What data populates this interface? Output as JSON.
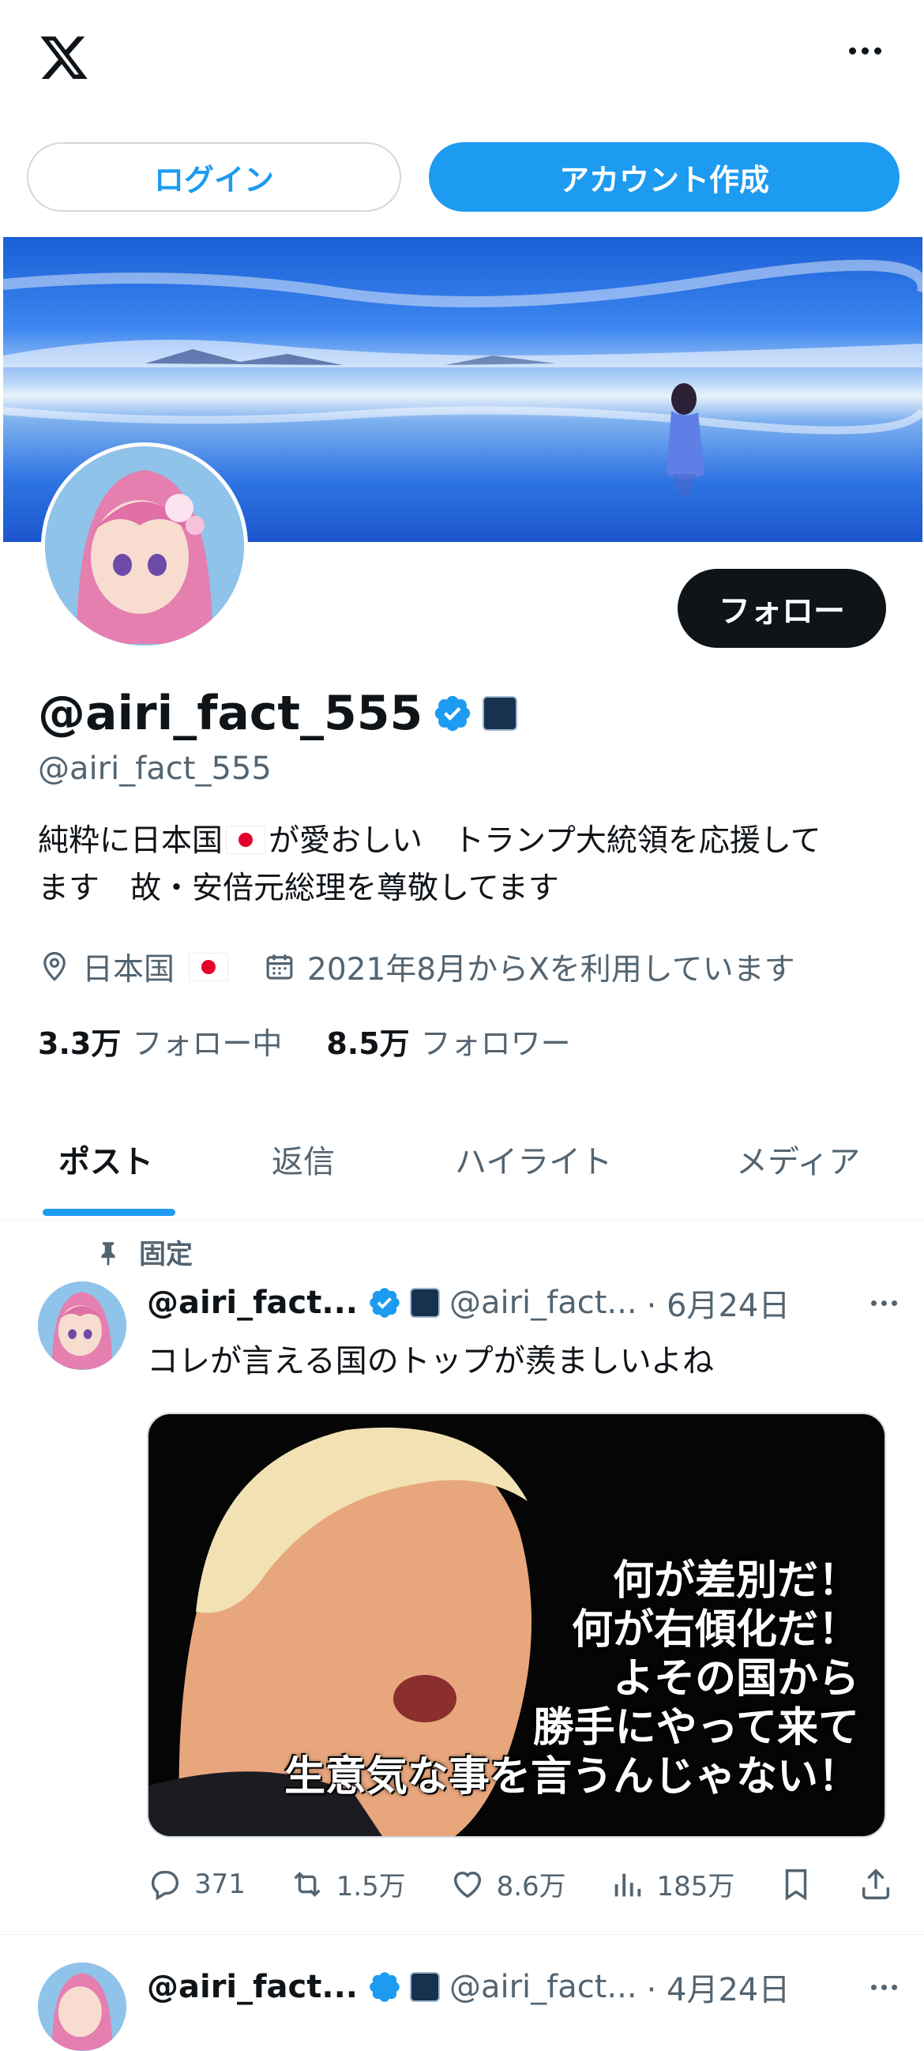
{
  "header": {
    "logo_icon": "x-logo-icon",
    "menu_icon": "more-icon"
  },
  "auth": {
    "login_label": "ログイン",
    "signup_label": "アカウント作成"
  },
  "profile": {
    "display_name": "@airi_fact_555",
    "handle": "@airi_fact_555",
    "follow_label": "フォロー",
    "bio_line1": "純粋に日本国",
    "bio_line1b": "が愛おしい　トランプ大統領を応援して",
    "bio_line2": "ます　故・安倍元総理を尊敬してます",
    "location": "日本国",
    "joined": "2021年8月からXを利用しています",
    "following_count": "3.3万",
    "following_label": "フォロー中",
    "followers_count": "8.5万",
    "followers_label": "フォロワー"
  },
  "tabs": [
    "ポスト",
    "返信",
    "ハイライト",
    "メディア"
  ],
  "posts": [
    {
      "pinned_label": "固定",
      "name": "@airi_fact...",
      "handle": "@airi_fact...",
      "date": "· 6月24日",
      "text": "コレが言える国のトップが羨ましいよね",
      "media_caption": [
        "何が差別だ！",
        "何が右傾化だ！",
        "よその国から",
        "勝手にやって来て",
        "生意気な事を言うんじゃない！"
      ],
      "replies": "371",
      "reposts": "1.5万",
      "likes": "8.6万",
      "views": "185万"
    },
    {
      "name": "@airi_fact...",
      "handle": "@airi_fact...",
      "date": "· 4月24日"
    }
  ],
  "colors": {
    "accent": "#1d9bf0",
    "text": "#0f1419",
    "muted": "#536471"
  }
}
